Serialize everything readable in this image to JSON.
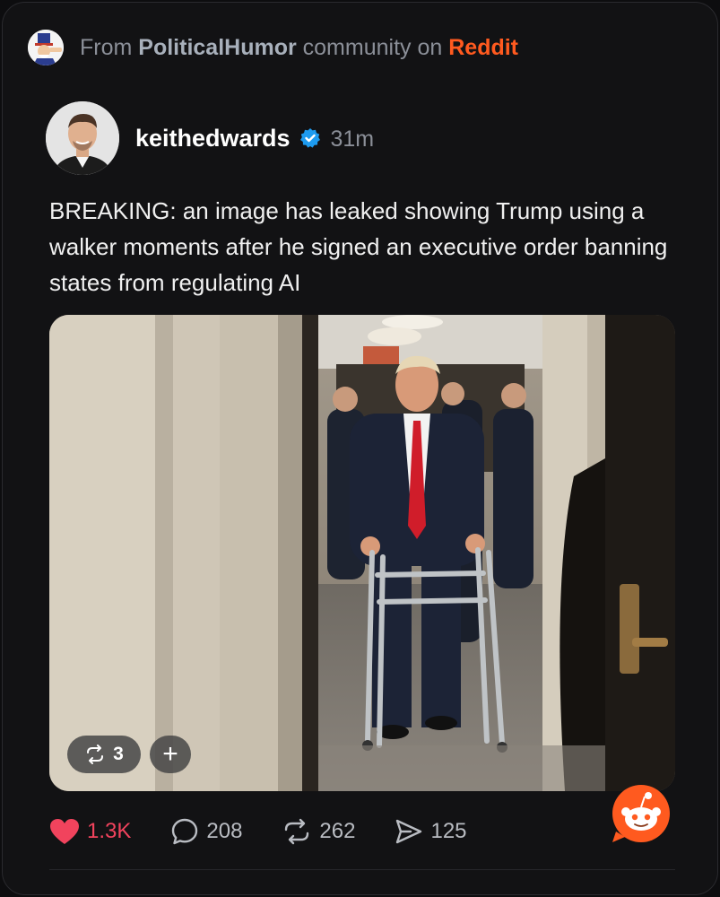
{
  "source": {
    "prefix": "From",
    "community": "PoliticalHumor",
    "middle": "community on",
    "platform": "Reddit"
  },
  "post": {
    "author": "keithedwards",
    "verified": true,
    "time": "31m",
    "text": "BREAKING: an image has leaked showing Trump using a walker moments after he signed an executive order banning states from regulating AI"
  },
  "media": {
    "gallery_count": "3",
    "add_label": "+"
  },
  "actions": {
    "likes": "1.3K",
    "comments": "208",
    "reposts": "262",
    "shares": "125"
  },
  "icons": [
    "uncle-sam-avatar",
    "verified-badge-icon",
    "heart-icon",
    "comment-icon",
    "repost-icon",
    "share-icon",
    "reddit-snoo-icon"
  ],
  "colors": {
    "accent_reddit": "#ff5a1f",
    "like": "#f1435d",
    "verified": "#1d9bf0"
  }
}
